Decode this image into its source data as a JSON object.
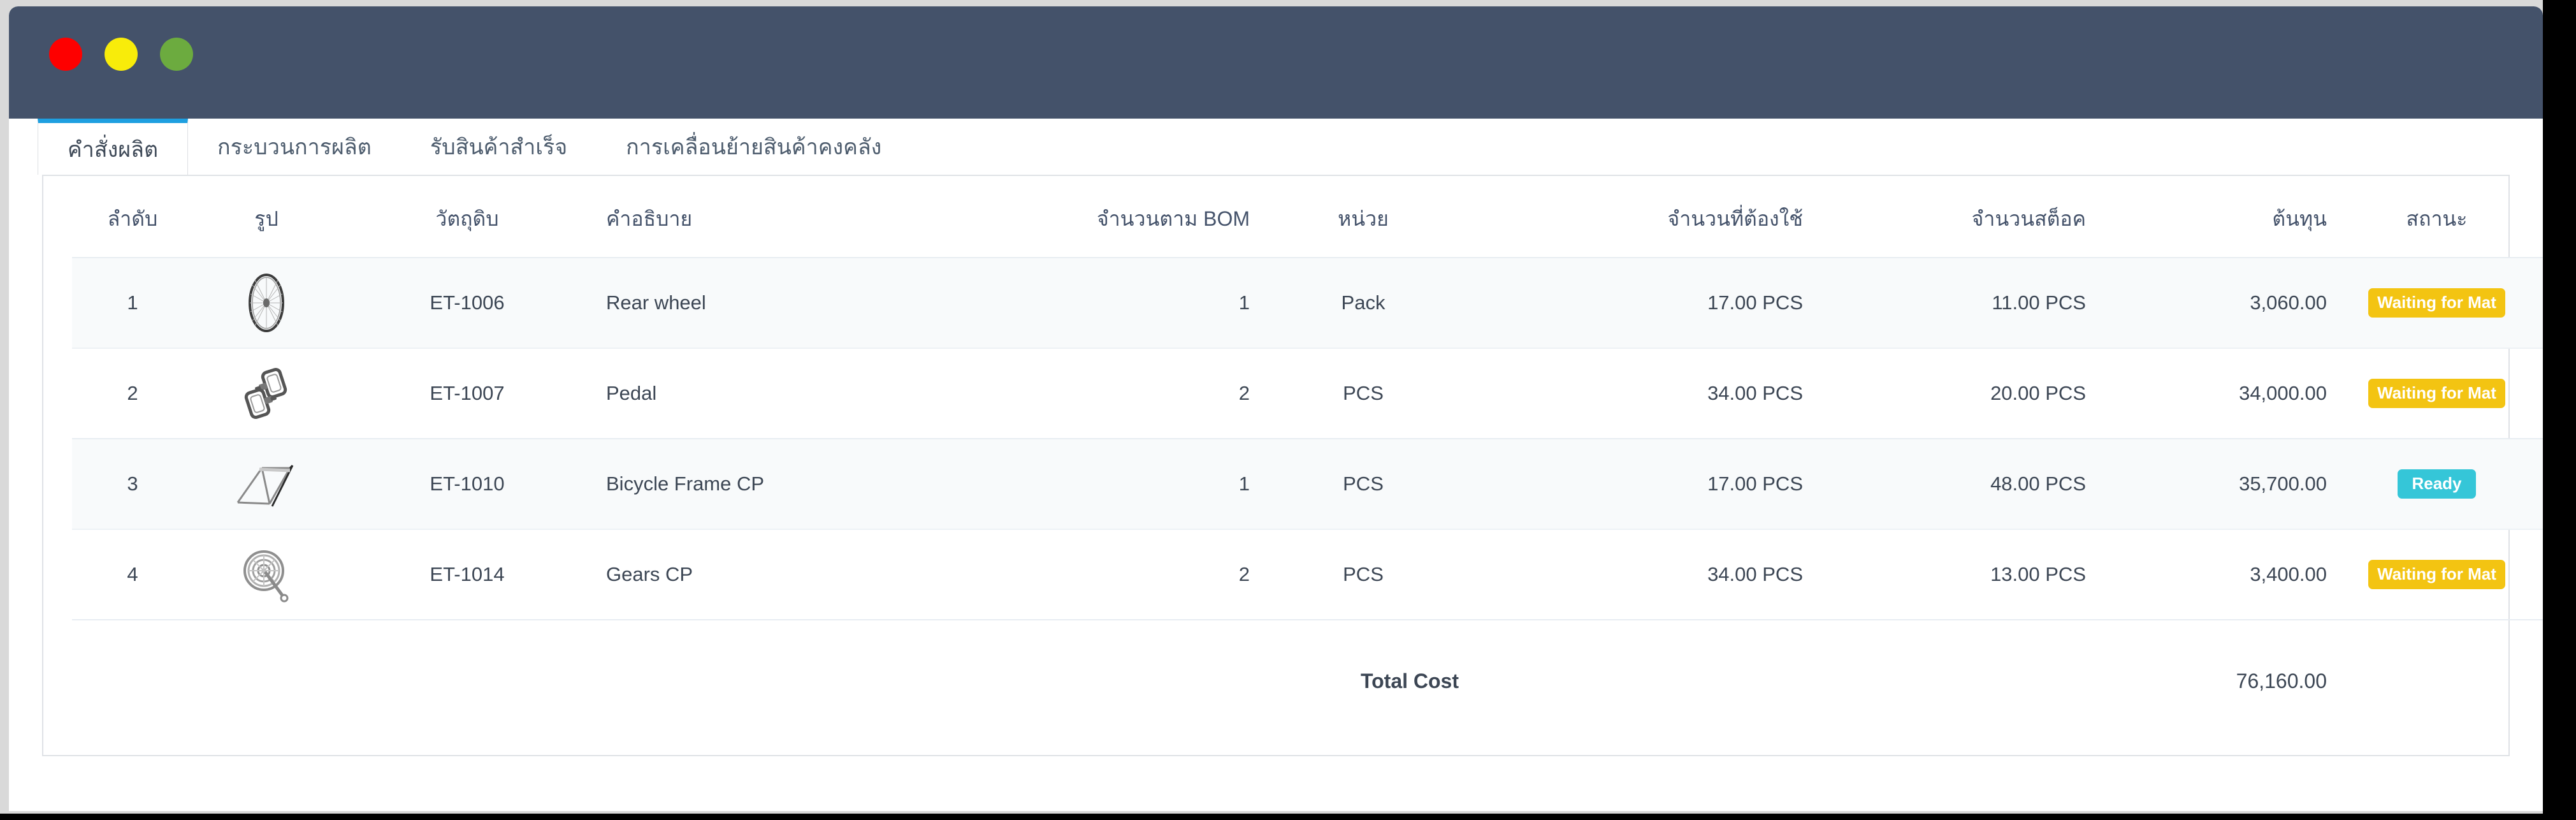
{
  "window": {
    "titlebar": {
      "buttons": [
        {
          "name": "close-button",
          "color": "#fe0000",
          "label": ""
        },
        {
          "name": "minimize-button",
          "color": "#f8ec0a",
          "label": ""
        },
        {
          "name": "maximize-button",
          "color": "#6cab3f",
          "label": ""
        }
      ],
      "background": "#44526a"
    }
  },
  "tabs": [
    {
      "label": "คำสั่งผลิต",
      "active": true
    },
    {
      "label": "กระบวนการผลิต",
      "active": false
    },
    {
      "label": "รับสินค้าสำเร็จ",
      "active": false
    },
    {
      "label": "การเคลื่อนย้ายสินค้าคงคลัง",
      "active": false
    }
  ],
  "table": {
    "headers": {
      "seq": "ลำดับ",
      "image": "รูป",
      "material": "วัตถุดิบ",
      "description": "คำอธิบาย",
      "bom_qty": "จำนวนตาม BOM",
      "unit": "หน่วย",
      "required_qty": "จำนวนที่ต้องใช้",
      "stock_qty": "จำนวนสต็อค",
      "cost": "ต้นทุน",
      "status": "สถานะ"
    },
    "rows": [
      {
        "seq": "1",
        "image_icon": "bicycle-wheel-icon",
        "material": "ET-1006",
        "description": "Rear wheel",
        "bom_qty": "1",
        "unit": "Pack",
        "required_qty": "17.00 PCS",
        "stock_qty": "11.00 PCS",
        "cost": "3,060.00",
        "status": "Waiting for Mat",
        "status_kind": "waiting"
      },
      {
        "seq": "2",
        "image_icon": "bicycle-pedal-icon",
        "material": "ET-1007",
        "description": "Pedal",
        "bom_qty": "2",
        "unit": "PCS",
        "required_qty": "34.00 PCS",
        "stock_qty": "20.00 PCS",
        "cost": "34,000.00",
        "status": "Waiting for Mat",
        "status_kind": "waiting"
      },
      {
        "seq": "3",
        "image_icon": "bicycle-frame-icon",
        "material": "ET-1010",
        "description": "Bicycle Frame CP",
        "bom_qty": "1",
        "unit": "PCS",
        "required_qty": "17.00 PCS",
        "stock_qty": "48.00 PCS",
        "cost": "35,700.00",
        "status": "Ready",
        "status_kind": "ready"
      },
      {
        "seq": "4",
        "image_icon": "bicycle-gears-icon",
        "material": "ET-1014",
        "description": "Gears CP",
        "bom_qty": "2",
        "unit": "PCS",
        "required_qty": "34.00 PCS",
        "stock_qty": "13.00 PCS",
        "cost": "3,400.00",
        "status": "Waiting for Mat",
        "status_kind": "waiting"
      }
    ],
    "footer": {
      "total_label": "Total Cost",
      "total_value": "76,160.00"
    }
  },
  "colors": {
    "titlebar": "#44526a",
    "active_tab_accent": "#1e9fe0",
    "badge_waiting": "#f3c412",
    "badge_ready": "#35c6d8",
    "row_stripe": "#f8fafb"
  }
}
